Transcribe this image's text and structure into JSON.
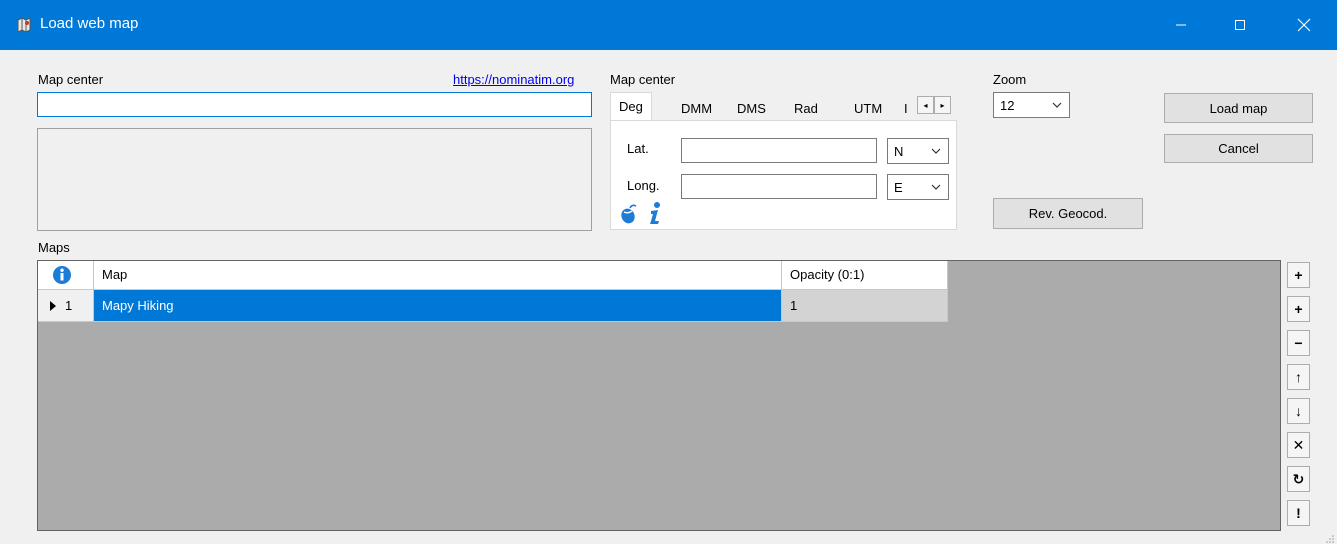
{
  "window": {
    "title": "Load web map",
    "icon": "map-icon",
    "minimize_icon": "minimize-icon",
    "maximize_icon": "maximize-icon",
    "close_icon": "close-icon"
  },
  "search": {
    "label": "Map center",
    "link": "https://nominatim.org",
    "value": ""
  },
  "coords": {
    "label": "Map center",
    "tabs": [
      "Deg",
      "DMM",
      "DMS",
      "Rad",
      "UTM",
      "I"
    ],
    "active_tab": "Deg",
    "lat_label": "Lat.",
    "lat_value": "",
    "lat_hemisphere": "N",
    "long_label": "Long.",
    "long_value": "",
    "long_hemisphere": "E",
    "scroll_left": "◂",
    "scroll_right": "▸"
  },
  "zoom": {
    "label": "Zoom",
    "value": "12"
  },
  "buttons": {
    "load_map": "Load map",
    "cancel": "Cancel",
    "rev_geocod": "Rev. Geocod."
  },
  "maps": {
    "label": "Maps",
    "columns": [
      "Map",
      "Opacity (0:1)"
    ],
    "rows": [
      {
        "index": "1",
        "map": "Mapy Hiking",
        "opacity": "1",
        "selected": true
      }
    ]
  },
  "side_buttons": [
    {
      "name": "add-button",
      "glyph": "+"
    },
    {
      "name": "insert-button",
      "glyph": "+"
    },
    {
      "name": "remove-button",
      "glyph": "−"
    },
    {
      "name": "move-up-button",
      "glyph": "↑"
    },
    {
      "name": "move-down-button",
      "glyph": "↓"
    },
    {
      "name": "delete-button",
      "glyph": "✕"
    },
    {
      "name": "refresh-button",
      "glyph": "↻"
    },
    {
      "name": "alert-button",
      "glyph": "!"
    }
  ],
  "colors": {
    "titlebar": "#0078d7",
    "selection": "#0078d7",
    "grid_background": "#ababab",
    "info_icon": "#1e7bd6"
  }
}
